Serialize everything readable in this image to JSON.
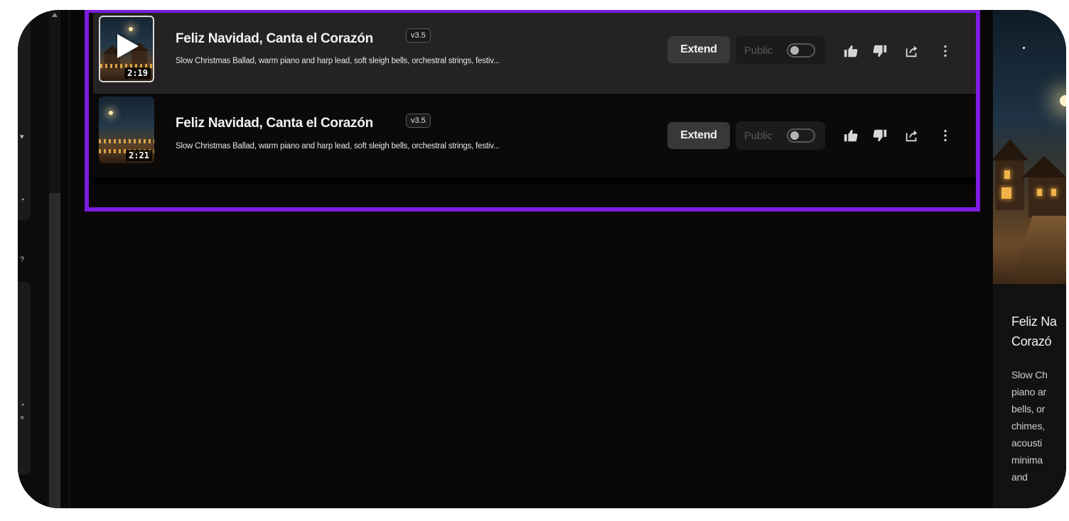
{
  "songs": [
    {
      "title": "Feliz Navidad, Canta el Corazón",
      "version": "v3.5",
      "description": "Slow Christmas Ballad, warm piano and harp lead, soft sleigh bells, orchestral strings, festiv...",
      "duration": "2:19",
      "extend_label": "Extend",
      "public_label": "Public",
      "public_enabled": false,
      "playing_hover": true
    },
    {
      "title": "Feliz Navidad, Canta el Corazón",
      "version": "v3.5",
      "description": "Slow Christmas Ballad, warm piano and harp lead, soft sleigh bells, orchestral strings, festiv...",
      "duration": "2:21",
      "extend_label": "Extend",
      "public_label": "Public",
      "public_enabled": false,
      "playing_hover": false
    }
  ],
  "icons": {
    "like": "thumbs-up-icon",
    "dislike": "thumbs-down-icon",
    "share": "share-icon",
    "more": "more-vertical-icon",
    "play": "play-icon"
  },
  "right_panel": {
    "title_lines": [
      "Feliz Na",
      "Corazó"
    ],
    "description_lines": [
      "Slow Ch",
      "piano ar",
      "bells, or",
      "chimes,",
      "acousti",
      "minima",
      "and"
    ]
  },
  "colors": {
    "highlight": "#7b1ce0",
    "background": "#0a0707",
    "row_selected": "#242222",
    "extend_button": "#3a3737"
  }
}
